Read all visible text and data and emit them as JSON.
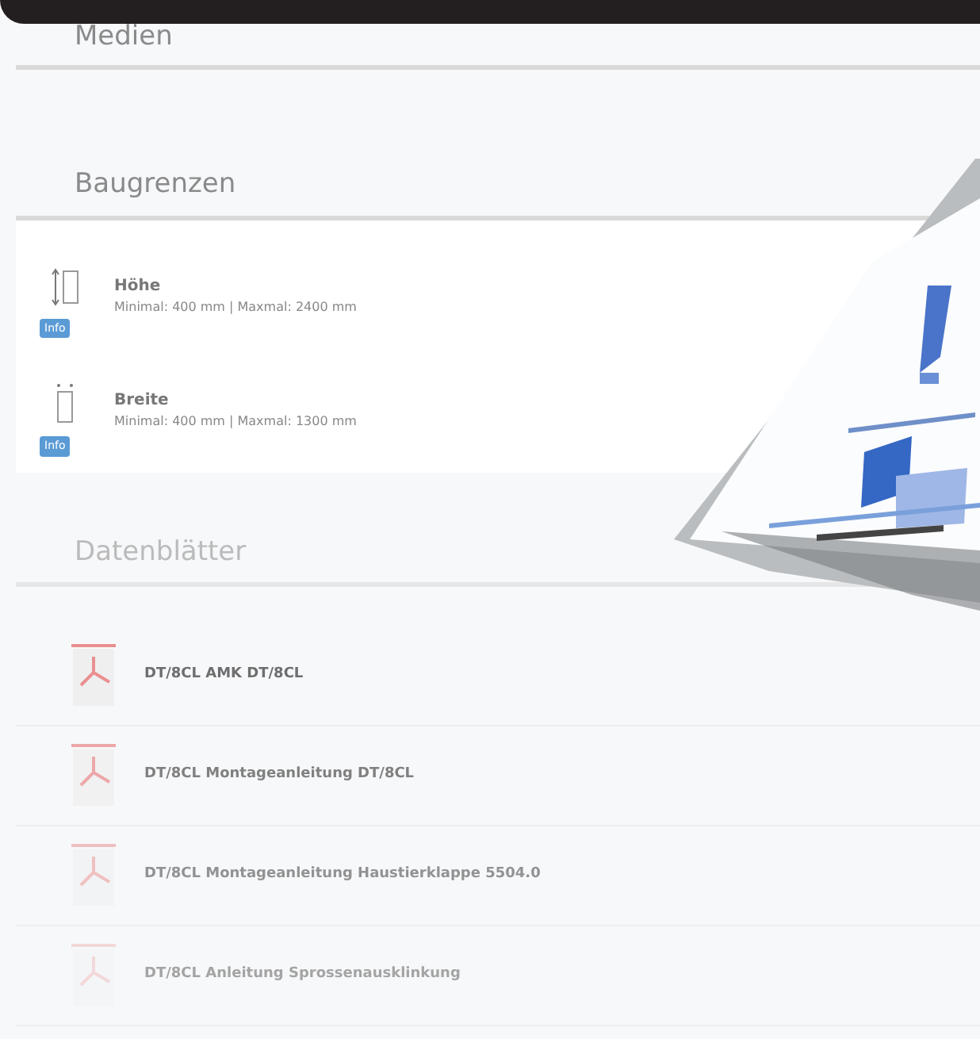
{
  "media": {
    "title": "Medien"
  },
  "limits": {
    "title": "Baugrenzen",
    "items": [
      {
        "kind": "height",
        "name": "Höhe",
        "range": "Minimal: 400 mm | Maxmal: 2400 mm",
        "badge": "Info"
      },
      {
        "kind": "width",
        "name": "Breite",
        "range": "Minimal: 400 mm | Maxmal: 1300 mm",
        "badge": "Info"
      }
    ]
  },
  "datasheets": {
    "title": "Datenblätter",
    "files": [
      {
        "name": "DT/8CL AMK DT/8CL"
      },
      {
        "name": "DT/8CL Montageanleitung DT/8CL"
      },
      {
        "name": "DT/8CL Montageanleitung Haustierklappe 5504.0"
      },
      {
        "name": "DT/8CL Anleitung Sprossenausklinkung"
      }
    ]
  }
}
